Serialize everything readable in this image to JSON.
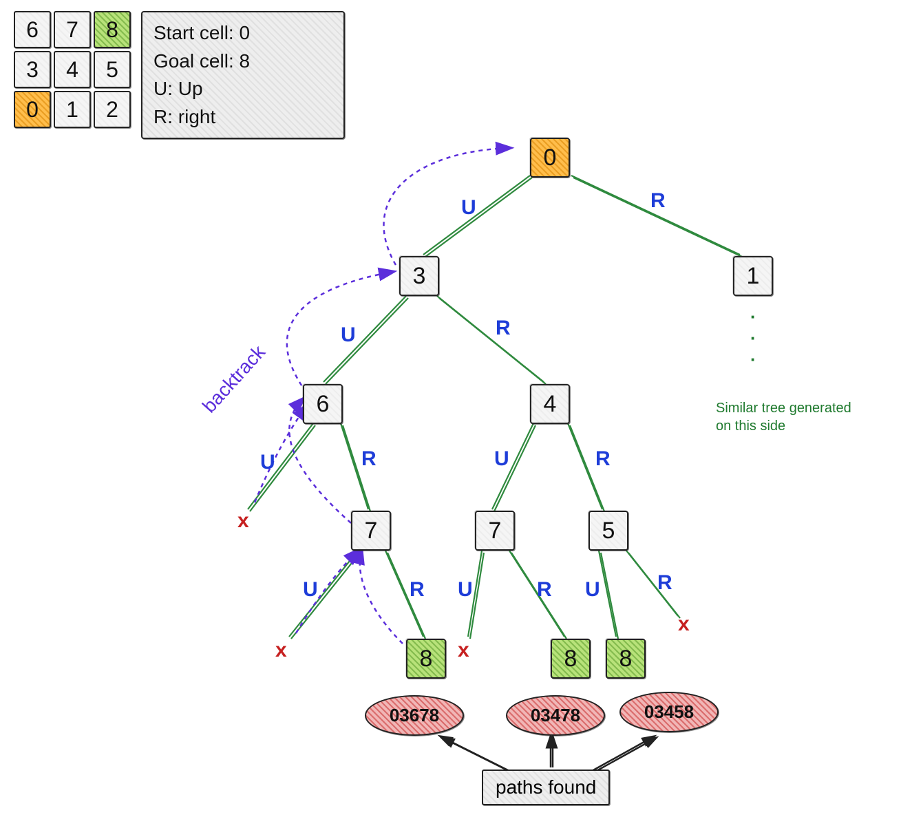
{
  "grid": {
    "cells": [
      {
        "v": "6"
      },
      {
        "v": "7"
      },
      {
        "v": "8"
      },
      {
        "v": "3"
      },
      {
        "v": "4"
      },
      {
        "v": "5"
      },
      {
        "v": "0"
      },
      {
        "v": "1"
      },
      {
        "v": "2"
      }
    ],
    "start_idx": 6,
    "goal_idx": 2
  },
  "legend": {
    "l1": "Start cell: 0",
    "l2": "Goal cell: 8",
    "l3": "U: Up",
    "l4": "R: right"
  },
  "tree": {
    "root": "0",
    "n3": "3",
    "n1": "1",
    "n6": "6",
    "n4": "4",
    "n7a": "7",
    "n7b": "7",
    "n5": "5",
    "n8a": "8",
    "n8b": "8",
    "n8c": "8"
  },
  "edge_labels": {
    "U": "U",
    "R": "R"
  },
  "tree_note": "Similar tree generated on this side",
  "backtrack": "backtrack",
  "dead": "x",
  "paths": {
    "p1": "03678",
    "p2": "03478",
    "p3": "03458",
    "label": "paths found"
  }
}
